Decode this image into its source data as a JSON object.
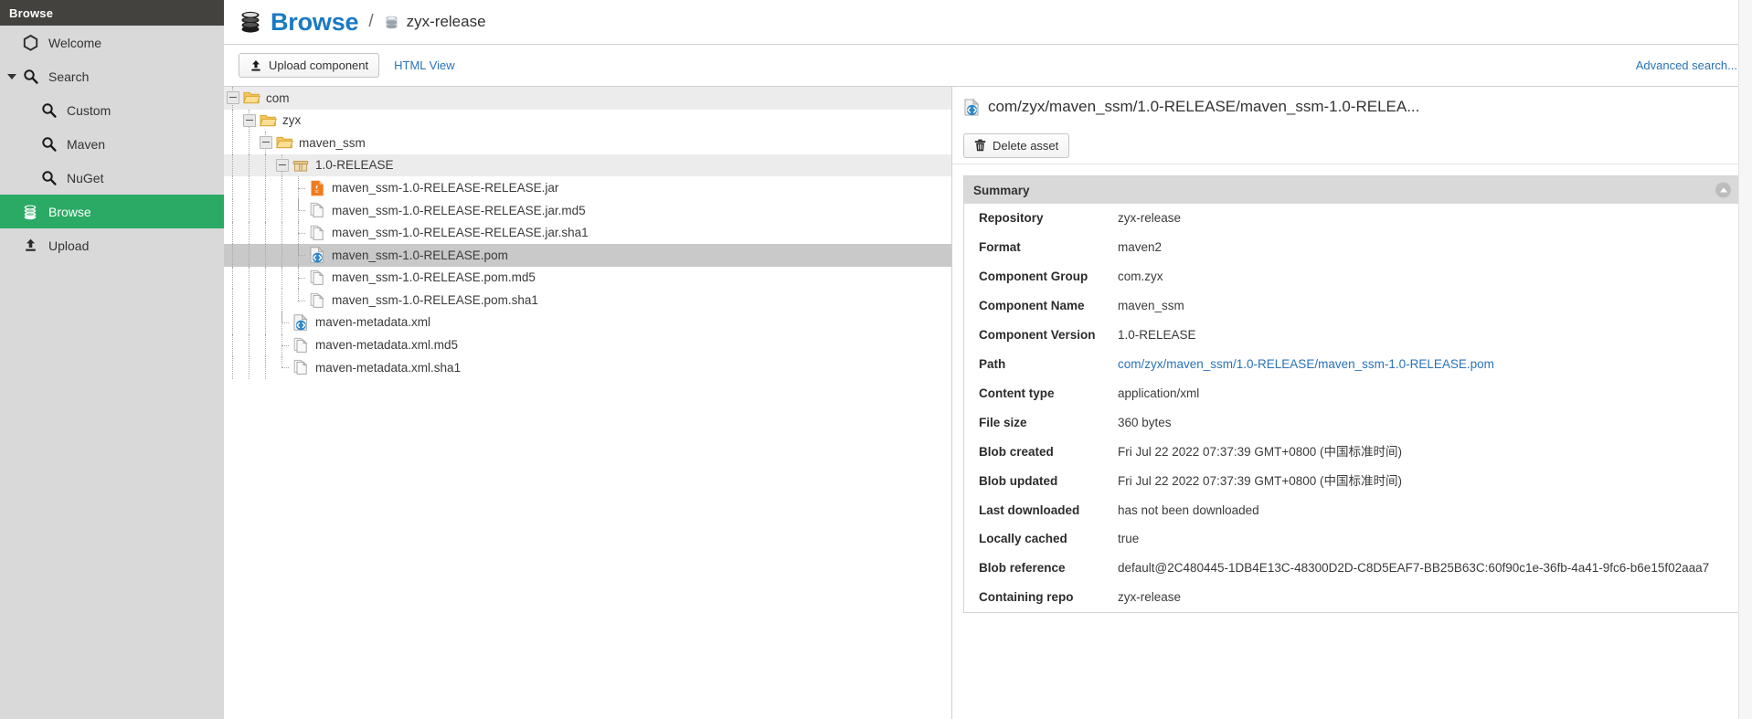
{
  "sidebar": {
    "header": "Browse",
    "items": [
      {
        "label": "Welcome",
        "icon": "hexagon-icon",
        "level": 0,
        "selected": false,
        "caret": false
      },
      {
        "label": "Search",
        "icon": "search-icon",
        "level": 0,
        "selected": false,
        "caret": true
      },
      {
        "label": "Custom",
        "icon": "search-icon",
        "level": 1,
        "selected": false,
        "caret": false
      },
      {
        "label": "Maven",
        "icon": "search-icon",
        "level": 1,
        "selected": false,
        "caret": false
      },
      {
        "label": "NuGet",
        "icon": "search-icon",
        "level": 1,
        "selected": false,
        "caret": false
      },
      {
        "label": "Browse",
        "icon": "database-icon",
        "level": 0,
        "selected": true,
        "caret": false
      },
      {
        "label": "Upload",
        "icon": "upload-icon",
        "level": 0,
        "selected": false,
        "caret": false
      }
    ]
  },
  "breadcrumb": {
    "title": "Browse",
    "separator": "/",
    "repository": "zyx-release"
  },
  "toolbar": {
    "upload_label": "Upload component",
    "html_view_label": "HTML View",
    "advanced_search_label": "Advanced search..."
  },
  "tree": {
    "rows": [
      {
        "label": "com",
        "icon": "folder-open-icon",
        "depth": 0,
        "type": "folder",
        "state": "hover",
        "expanded": true
      },
      {
        "label": "zyx",
        "icon": "folder-open-icon",
        "depth": 1,
        "type": "folder",
        "state": "none",
        "expanded": true
      },
      {
        "label": "maven_ssm",
        "icon": "folder-open-icon",
        "depth": 2,
        "type": "folder",
        "state": "none",
        "expanded": true
      },
      {
        "label": "1.0-RELEASE",
        "icon": "package-icon",
        "depth": 3,
        "type": "folder",
        "state": "hover",
        "expanded": true
      },
      {
        "label": "maven_ssm-1.0-RELEASE-RELEASE.jar",
        "icon": "jar-icon",
        "depth": 4,
        "type": "file",
        "state": "none"
      },
      {
        "label": "maven_ssm-1.0-RELEASE-RELEASE.jar.md5",
        "icon": "checksum-icon",
        "depth": 4,
        "type": "file",
        "state": "none"
      },
      {
        "label": "maven_ssm-1.0-RELEASE-RELEASE.jar.sha1",
        "icon": "checksum-icon",
        "depth": 4,
        "type": "file",
        "state": "none"
      },
      {
        "label": "maven_ssm-1.0-RELEASE.pom",
        "icon": "xml-icon",
        "depth": 4,
        "type": "file",
        "state": "selected"
      },
      {
        "label": "maven_ssm-1.0-RELEASE.pom.md5",
        "icon": "checksum-icon",
        "depth": 4,
        "type": "file",
        "state": "none"
      },
      {
        "label": "maven_ssm-1.0-RELEASE.pom.sha1",
        "icon": "checksum-icon",
        "depth": 4,
        "type": "file",
        "state": "none"
      },
      {
        "label": "maven-metadata.xml",
        "icon": "xml-icon",
        "depth": 3,
        "type": "file",
        "state": "none"
      },
      {
        "label": "maven-metadata.xml.md5",
        "icon": "checksum-icon",
        "depth": 3,
        "type": "file",
        "state": "none"
      },
      {
        "label": "maven-metadata.xml.sha1",
        "icon": "checksum-icon",
        "depth": 3,
        "type": "file",
        "state": "none"
      }
    ]
  },
  "detail": {
    "title": "com/zyx/maven_ssm/1.0-RELEASE/maven_ssm-1.0-RELEA...",
    "delete_label": "Delete asset",
    "summary_header": "Summary",
    "summary_rows": [
      {
        "key": "Repository",
        "value": "zyx-release",
        "link": false
      },
      {
        "key": "Format",
        "value": "maven2",
        "link": false
      },
      {
        "key": "Component Group",
        "value": "com.zyx",
        "link": false
      },
      {
        "key": "Component Name",
        "value": "maven_ssm",
        "link": false
      },
      {
        "key": "Component Version",
        "value": "1.0-RELEASE",
        "link": false
      },
      {
        "key": "Path",
        "value": "com/zyx/maven_ssm/1.0-RELEASE/maven_ssm-1.0-RELEASE.pom",
        "link": true
      },
      {
        "key": "Content type",
        "value": "application/xml",
        "link": false
      },
      {
        "key": "File size",
        "value": "360 bytes",
        "link": false
      },
      {
        "key": "Blob created",
        "value": "Fri Jul 22 2022 07:37:39 GMT+0800 (中国标准时间)",
        "link": false
      },
      {
        "key": "Blob updated",
        "value": "Fri Jul 22 2022 07:37:39 GMT+0800 (中国标准时间)",
        "link": false
      },
      {
        "key": "Last downloaded",
        "value": "has not been downloaded",
        "link": false
      },
      {
        "key": "Locally cached",
        "value": "true",
        "link": false
      },
      {
        "key": "Blob reference",
        "value": "default@2C480445-1DB4E13C-48300D2D-C8D5EAF7-BB25B63C:60f90c1e-36fb-4a41-9fc6-b6e15f02aaa7",
        "link": false
      },
      {
        "key": "Containing repo",
        "value": "zyx-release",
        "link": false
      }
    ]
  },
  "colors": {
    "accent_green": "#2aaa64",
    "link_blue": "#2a73b8",
    "title_blue": "#197ac5",
    "sidebar_bg": "#d9d9d9",
    "sidebar_header_bg": "#44423f",
    "selected_row": "#c9c9c9"
  }
}
